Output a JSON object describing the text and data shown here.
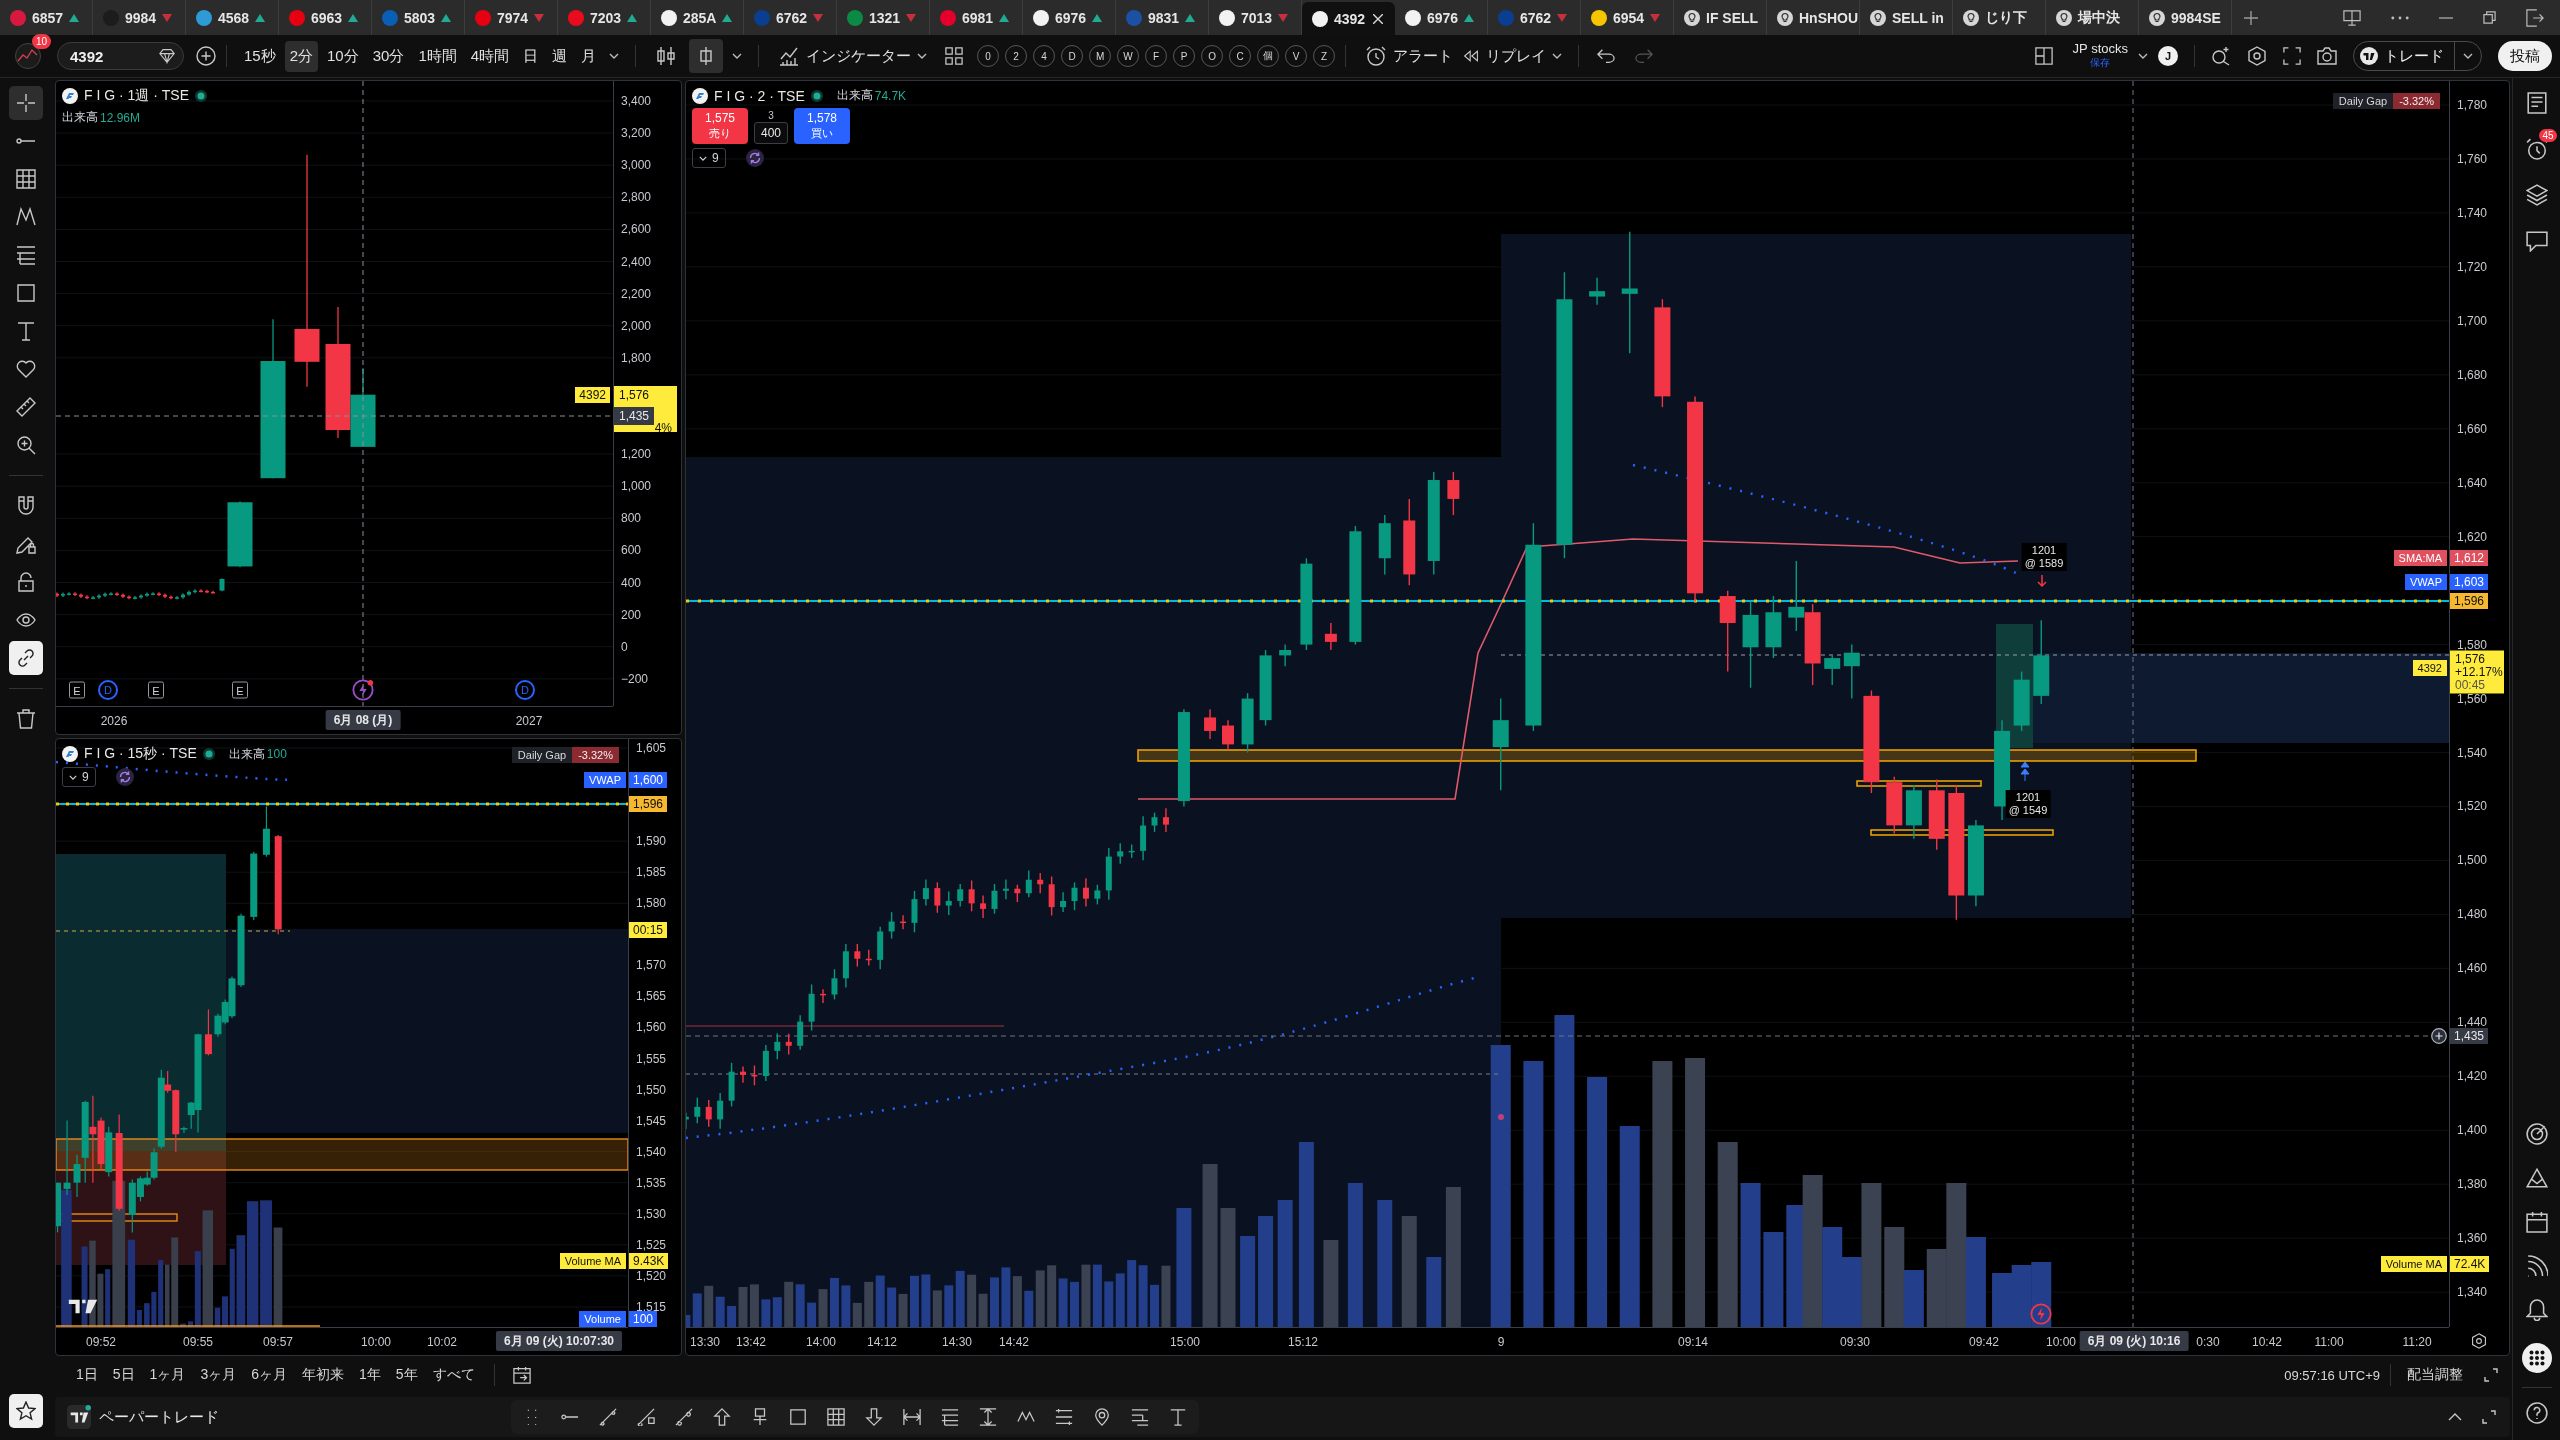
{
  "tabs": [
    {
      "kind": "ticker",
      "label": "6857",
      "rising": true,
      "color": "#d7193f",
      "selected": false
    },
    {
      "kind": "ticker",
      "label": "9984",
      "rising": false,
      "color": "#1c1c1c",
      "selected": false
    },
    {
      "kind": "ticker",
      "label": "4568",
      "rising": true,
      "color": "#2f9bd6",
      "selected": false
    },
    {
      "kind": "ticker",
      "label": "6963",
      "rising": true,
      "color": "#e60012",
      "selected": false
    },
    {
      "kind": "ticker",
      "label": "5803",
      "rising": true,
      "color": "#0a5eb4",
      "selected": false
    },
    {
      "kind": "ticker",
      "label": "7974",
      "rising": false,
      "color": "#e60012",
      "selected": false
    },
    {
      "kind": "ticker",
      "label": "7203",
      "rising": true,
      "color": "#eb0a1e",
      "selected": false
    },
    {
      "kind": "ticker",
      "label": "285A",
      "rising": true,
      "color": "#f2f2f2",
      "selected": false
    },
    {
      "kind": "ticker",
      "label": "6762",
      "rising": false,
      "color": "#0b3e8f",
      "selected": false
    },
    {
      "kind": "ticker",
      "label": "1321",
      "rising": false,
      "color": "#0a8a45",
      "selected": false
    },
    {
      "kind": "ticker",
      "label": "6981",
      "rising": true,
      "color": "#e4002b",
      "selected": false
    },
    {
      "kind": "ticker",
      "label": "6976",
      "rising": true,
      "color": "#f2f2f2",
      "selected": false
    },
    {
      "kind": "ticker",
      "label": "9831",
      "rising": true,
      "color": "#1d50a2",
      "selected": false
    },
    {
      "kind": "ticker",
      "label": "7013",
      "rising": false,
      "color": "#f2f2f2",
      "selected": false
    },
    {
      "kind": "ticker",
      "label": "4392",
      "color": "#f2f2f2",
      "selected": true
    },
    {
      "kind": "ticker",
      "label": "6976",
      "rising": true,
      "color": "#f2f2f2",
      "selected": false
    },
    {
      "kind": "ticker",
      "label": "6762",
      "rising": false,
      "color": "#0b3e8f",
      "selected": false
    },
    {
      "kind": "ticker",
      "label": "6954",
      "rising": false,
      "color": "#f7c500",
      "selected": false
    },
    {
      "kind": "alert",
      "label": "IF SELL",
      "selected": false
    },
    {
      "kind": "alert",
      "label": "HnSHOU",
      "selected": false
    },
    {
      "kind": "alert",
      "label": "SELL in",
      "selected": false
    },
    {
      "kind": "alert",
      "label": "じり下",
      "selected": false
    },
    {
      "kind": "alert",
      "label": "場中決",
      "selected": false
    },
    {
      "kind": "alert",
      "label": "9984SE",
      "selected": false
    }
  ],
  "toolbar": {
    "notification_count": "10",
    "symbol": "4392",
    "intervals": [
      {
        "label": "15秒",
        "selected": false
      },
      {
        "label": "2分",
        "selected": true
      },
      {
        "label": "10分",
        "selected": false
      },
      {
        "label": "30分",
        "selected": false
      },
      {
        "label": "1時間",
        "selected": false
      },
      {
        "label": "4時間",
        "selected": false
      },
      {
        "label": "日",
        "selected": false
      },
      {
        "label": "週",
        "selected": false
      },
      {
        "label": "月",
        "selected": false
      }
    ],
    "chart_types": [
      {
        "selected": false
      },
      {
        "selected": true
      }
    ],
    "indicators": "インジケーター",
    "quick_buttons": [
      "0",
      "2",
      "4",
      "D",
      "M",
      "W",
      "F",
      "P",
      "O",
      "C",
      "個",
      "V",
      "Z"
    ],
    "alert": "アラート",
    "replay": "リプレイ",
    "watchlist": "JP stocks",
    "save_status": "保存",
    "user_initial": "J",
    "trade": "トレード",
    "publish": "投稿"
  },
  "drawing_tools": [
    {
      "selected": true
    },
    {
      "selected": false
    },
    {
      "selected": false
    },
    {
      "selected": false
    },
    {
      "selected": false
    },
    {
      "selected": false
    },
    {
      "selected": false
    },
    {
      "selected": false
    },
    {
      "selected": false
    },
    {
      "selected": false
    }
  ],
  "toggles": [
    {
      "on": false
    },
    {
      "on": false
    },
    {
      "on": false
    },
    {
      "on": false
    },
    {
      "on": true
    }
  ],
  "weekly_chart": {
    "title": "F I G · 1週 · TSE",
    "volume_label": "出来高",
    "volume": "12.96M",
    "price_axis": [
      "3,400",
      "3,200",
      "3,000",
      "2,800",
      "2,600",
      "2,400",
      "2,200",
      "2,000",
      "1,800",
      "1,200",
      "1,000",
      "800",
      "600",
      "400",
      "200",
      "0",
      "−200"
    ],
    "symbol_tag": "4392",
    "last_price": "1,576",
    "change_fragment": "4%",
    "crosshair_price": "1,435",
    "events": [
      {
        "kind": "earnings",
        "label": "E"
      },
      {
        "kind": "dividend",
        "label": "D"
      },
      {
        "kind": "earnings",
        "label": "E"
      },
      {
        "kind": "earnings",
        "label": "E"
      },
      {
        "kind": "news"
      },
      {
        "kind": "dividend",
        "label": "D"
      }
    ],
    "time_axis": [
      "2026",
      "2027"
    ],
    "crosshair_date": "6月 08 (月)"
  },
  "seconds_chart": {
    "title": "F I G · 15秒 · TSE",
    "volume_label": "出来高",
    "volume": "100",
    "legend_count": "9",
    "daily_gap": {
      "label": "Daily Gap",
      "value": "-3.32%"
    },
    "price_axis": [
      "1,605",
      "1,590",
      "1,585",
      "1,580",
      "1,570",
      "1,565",
      "1,560",
      "1,555",
      "1,550",
      "1,545",
      "1,540",
      "1,535",
      "1,530",
      "1,525",
      "1,520",
      "1,515"
    ],
    "badges": [
      {
        "kind": "vwap",
        "label": "VWAP",
        "value": "1,600"
      },
      {
        "kind": "level",
        "value": "1,596"
      },
      {
        "kind": "countdown",
        "value": "00:15"
      },
      {
        "kind": "volume_ma",
        "label": "Volume MA",
        "value": "9.43K"
      },
      {
        "kind": "volume",
        "label": "Volume",
        "value": "100"
      }
    ],
    "time_axis": [
      "09:52",
      "09:55",
      "09:57",
      "10:00",
      "10:02"
    ],
    "crosshair_time": "6月 09 (火) 10:07:30"
  },
  "main_chart": {
    "title": "F I G · 2 · TSE",
    "volume_label": "出来高",
    "volume": "74.7K",
    "sell": {
      "price": "1,575",
      "label": "売り"
    },
    "spread": "3",
    "quantity": "400",
    "buy": {
      "price": "1,578",
      "label": "買い"
    },
    "legend_count": "9",
    "daily_gap": {
      "label": "Daily Gap",
      "value": "-3.32%"
    },
    "price_axis": [
      "1,780",
      "1,760",
      "1,740",
      "1,720",
      "1,700",
      "1,680",
      "1,660",
      "1,640",
      "1,620",
      "1,580",
      "1,560",
      "1,540",
      "1,520",
      "1,500",
      "1,480",
      "1,460",
      "1,440",
      "1,420",
      "1,400",
      "1,380",
      "1,360",
      "1,340"
    ],
    "badges": [
      {
        "kind": "sma",
        "label": "SMA:MA",
        "value": "1,612"
      },
      {
        "kind": "vwap",
        "label": "VWAP",
        "value": "1,603"
      },
      {
        "kind": "level",
        "value": "1,596"
      },
      {
        "kind": "last",
        "label": "4392",
        "value": "1,576",
        "change": "+12.17%",
        "countdown": "00:45"
      },
      {
        "kind": "crosshair",
        "value": "1,435"
      },
      {
        "kind": "volume_ma",
        "label": "Volume MA",
        "value": "72.4K"
      }
    ],
    "orders": [
      {
        "kind": "sell",
        "quantity": "1201",
        "price": "@ 1589"
      },
      {
        "kind": "buy",
        "quantity": "1201",
        "price": "@ 1549"
      }
    ],
    "time_axis": [
      "13:30",
      "13:42",
      "14:00",
      "14:12",
      "14:30",
      "14:42",
      "15:00",
      "15:12",
      "9",
      "09:14",
      "09:30",
      "09:42",
      "10:00",
      "0:30",
      "10:42",
      "11:00",
      "11:20"
    ],
    "crosshair_time": "6月 09 (火) 10:16"
  },
  "range_bar": {
    "ranges": [
      "1日",
      "5日",
      "1ヶ月",
      "3ヶ月",
      "6ヶ月",
      "年初来",
      "1年",
      "5年",
      "すべて"
    ],
    "clock": "09:57:16 UTC+9",
    "adjustment": "配当調整"
  },
  "right_toolbar": {
    "alert_count": "45"
  },
  "bottom_panel": {
    "title": "ペーパートレード"
  }
}
